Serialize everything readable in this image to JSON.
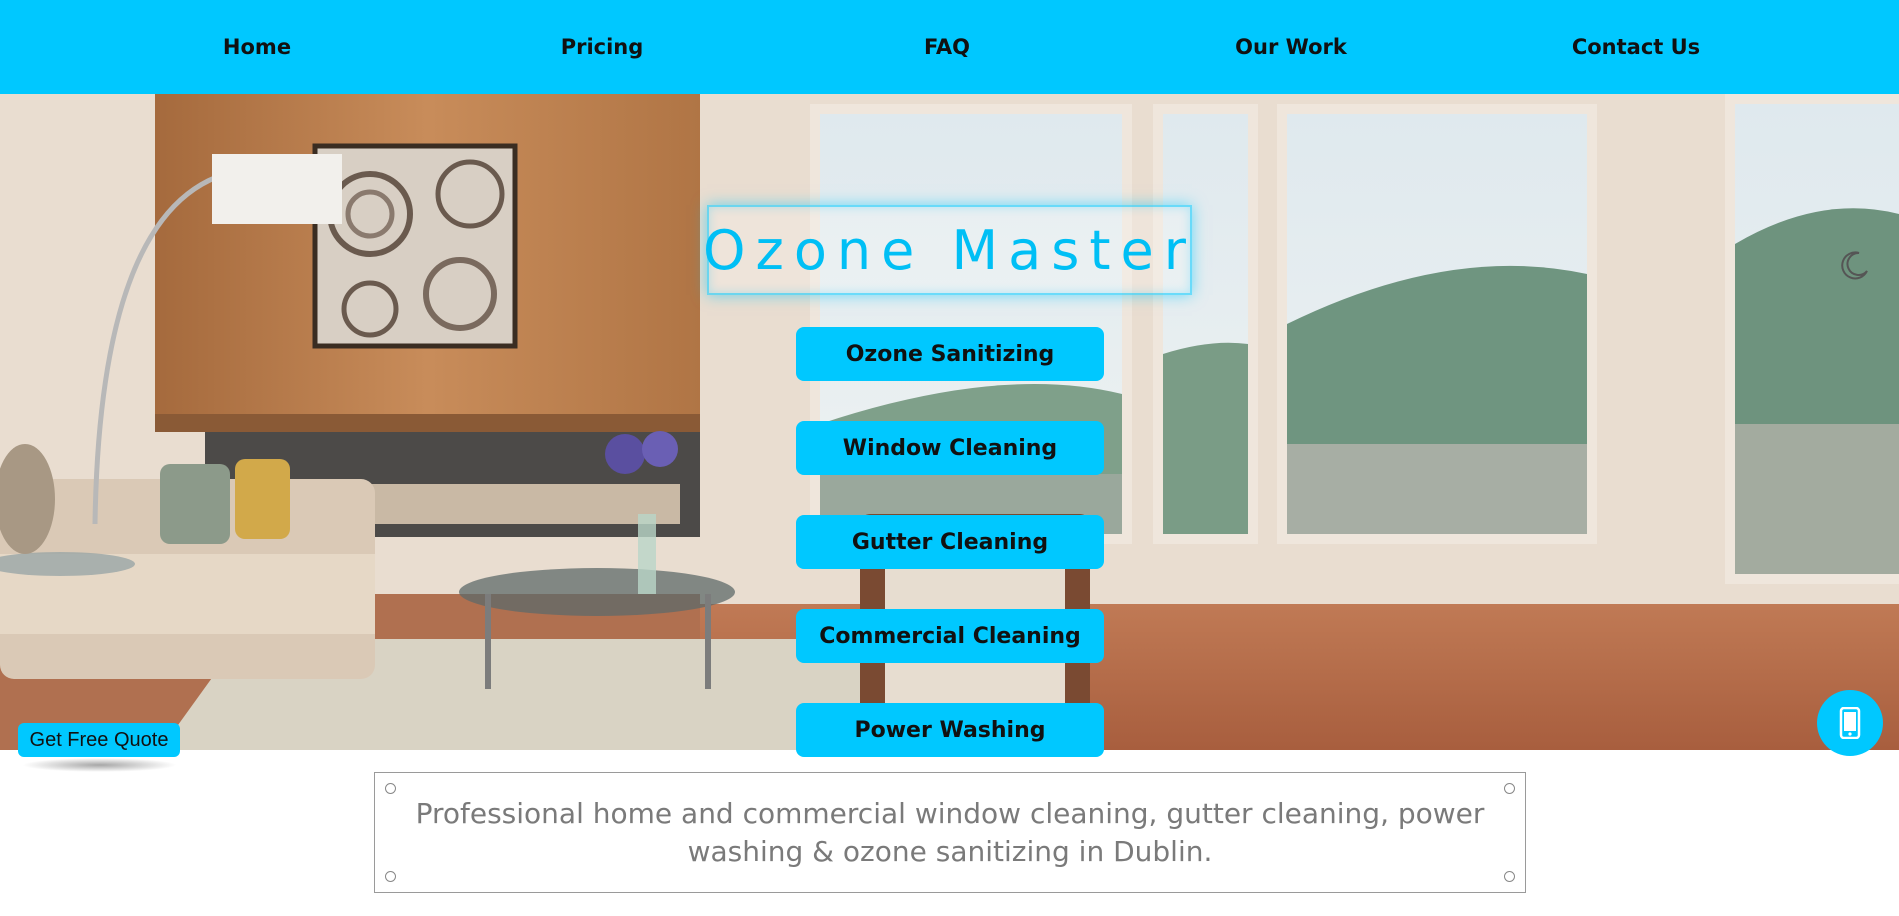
{
  "nav": {
    "items": [
      {
        "label": "Home"
      },
      {
        "label": "Pricing"
      },
      {
        "label": "FAQ"
      },
      {
        "label": "Our Work"
      },
      {
        "label": "Contact Us"
      }
    ]
  },
  "hero": {
    "title": "Ozone Master",
    "services": [
      {
        "label": "Ozone Sanitizing"
      },
      {
        "label": "Window Cleaning"
      },
      {
        "label": "Gutter Cleaning"
      },
      {
        "label": "Commercial Cleaning"
      },
      {
        "label": "Power Washing"
      }
    ],
    "theme_toggle_icon": "moon-icon",
    "phone_icon": "mobile-phone-icon"
  },
  "quote_button": {
    "label": "Get Free Quote"
  },
  "description": {
    "text": "Professional home and commercial window cleaning, gutter cleaning, power washing & ozone sanitizing in Dublin."
  },
  "colors": {
    "accent": "#00c8ff",
    "title_text": "#00bff5",
    "description_text": "#7a7a7a"
  }
}
